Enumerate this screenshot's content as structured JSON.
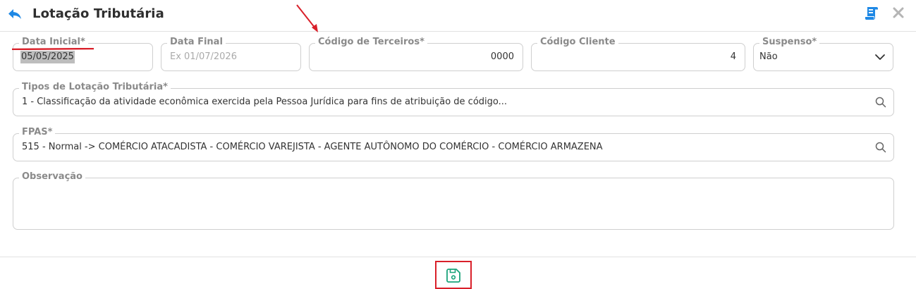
{
  "header": {
    "title": "Lotação Tributária",
    "back_icon": "arrow-back-icon",
    "scroll_icon": "scroll-document-icon",
    "close_icon": "close-icon"
  },
  "fields": {
    "data_inicial": {
      "label": "Data Inicial*",
      "value": "05/05/2025"
    },
    "data_final": {
      "label": "Data Final",
      "value": "",
      "placeholder": "Ex 01/07/2026"
    },
    "codigo_terceiros": {
      "label": "Código de Terceiros*",
      "value": "0000"
    },
    "codigo_cliente": {
      "label": "Código Cliente",
      "value": "4"
    },
    "suspenso": {
      "label": "Suspenso*",
      "value": "Não"
    },
    "tipos_lotacao": {
      "label": "Tipos de Lotação Tributária*",
      "value": "1 - Classificação da atividade econômica exercida pela Pessoa Jurídica para fins de atribuição de código..."
    },
    "fpas": {
      "label": "FPAS*",
      "value": "515 - Normal -> COMÉRCIO ATACADISTA - COMÉRCIO VAREJISTA - AGENTE AUTÔNOMO DO COMÉRCIO - COMÉRCIO ARMAZENA"
    },
    "observacao": {
      "label": "Observação",
      "value": ""
    }
  },
  "footer": {
    "save_icon": "floppy-disk-icon"
  },
  "colors": {
    "accent_blue": "#1e88e5",
    "save_green": "#1aa37a",
    "annotation_red": "#d9202a",
    "label_gray": "#8a8a8a",
    "border": "#cfcfcf"
  }
}
